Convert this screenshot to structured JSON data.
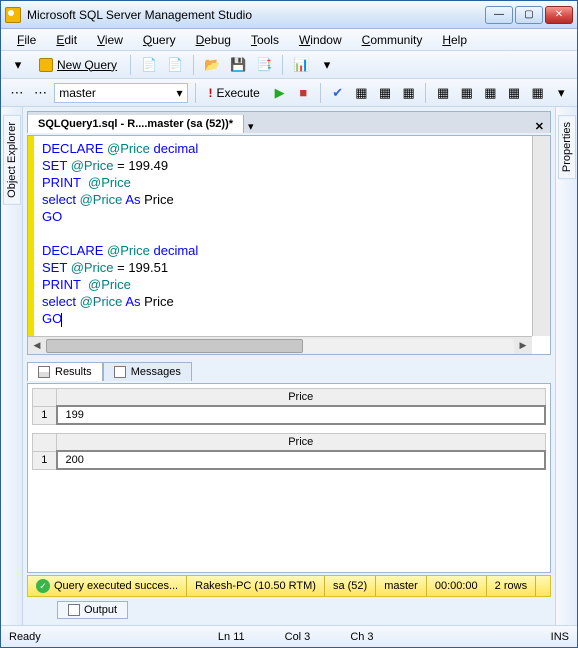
{
  "title": "Microsoft SQL Server Management Studio",
  "menu": [
    "File",
    "Edit",
    "View",
    "Query",
    "Debug",
    "Tools",
    "Window",
    "Community",
    "Help"
  ],
  "toolbar": {
    "new_query": "New Query"
  },
  "toolbar2": {
    "db": "master",
    "execute": "Execute"
  },
  "left_panel": "Object Explorer",
  "right_panel": "Properties",
  "tab_title": "SQLQuery1.sql - R....master (sa (52))*",
  "code_lines": [
    {
      "t": "kw",
      "v": "DECLARE"
    },
    {
      "t": "sp",
      "v": " "
    },
    {
      "t": "var",
      "v": "@Price"
    },
    {
      "t": "sp",
      "v": " "
    },
    {
      "t": "typ",
      "v": "decimal"
    },
    {
      "t": "nl"
    },
    {
      "t": "kw",
      "v": "SET"
    },
    {
      "t": "sp",
      "v": " "
    },
    {
      "t": "var",
      "v": "@Price"
    },
    {
      "t": "sp",
      "v": " = 199.49"
    },
    {
      "t": "nl"
    },
    {
      "t": "kw",
      "v": "PRINT"
    },
    {
      "t": "sp",
      "v": "  "
    },
    {
      "t": "var",
      "v": "@Price"
    },
    {
      "t": "nl"
    },
    {
      "t": "kw",
      "v": "select"
    },
    {
      "t": "sp",
      "v": " "
    },
    {
      "t": "var",
      "v": "@Price"
    },
    {
      "t": "sp",
      "v": " "
    },
    {
      "t": "kw",
      "v": "As"
    },
    {
      "t": "sp",
      "v": " Price"
    },
    {
      "t": "nl"
    },
    {
      "t": "kw",
      "v": "GO"
    },
    {
      "t": "nl"
    },
    {
      "t": "nl"
    },
    {
      "t": "kw",
      "v": "DECLARE"
    },
    {
      "t": "sp",
      "v": " "
    },
    {
      "t": "var",
      "v": "@Price"
    },
    {
      "t": "sp",
      "v": " "
    },
    {
      "t": "typ",
      "v": "decimal"
    },
    {
      "t": "nl"
    },
    {
      "t": "kw",
      "v": "SET"
    },
    {
      "t": "sp",
      "v": " "
    },
    {
      "t": "var",
      "v": "@Price"
    },
    {
      "t": "sp",
      "v": " = 199.51"
    },
    {
      "t": "nl"
    },
    {
      "t": "kw",
      "v": "PRINT"
    },
    {
      "t": "sp",
      "v": "  "
    },
    {
      "t": "var",
      "v": "@Price"
    },
    {
      "t": "nl"
    },
    {
      "t": "kw",
      "v": "select"
    },
    {
      "t": "sp",
      "v": " "
    },
    {
      "t": "var",
      "v": "@Price"
    },
    {
      "t": "sp",
      "v": " "
    },
    {
      "t": "kw",
      "v": "As"
    },
    {
      "t": "sp",
      "v": " Price"
    },
    {
      "t": "nl"
    },
    {
      "t": "kw",
      "v": "GO"
    },
    {
      "t": "cur"
    }
  ],
  "result_tabs": {
    "results": "Results",
    "messages": "Messages"
  },
  "grids": [
    {
      "header": "Price",
      "rows": [
        [
          "1",
          "199"
        ]
      ]
    },
    {
      "header": "Price",
      "rows": [
        [
          "1",
          "200"
        ]
      ]
    }
  ],
  "status_strip": {
    "ok": "Query executed succes...",
    "server": "Rakesh-PC (10.50 RTM)",
    "user": "sa (52)",
    "db": "master",
    "time": "00:00:00",
    "rows": "2 rows"
  },
  "output_tab": "Output",
  "statusbar": {
    "ready": "Ready",
    "ln": "Ln 11",
    "col": "Col 3",
    "ch": "Ch 3",
    "ins": "INS"
  }
}
